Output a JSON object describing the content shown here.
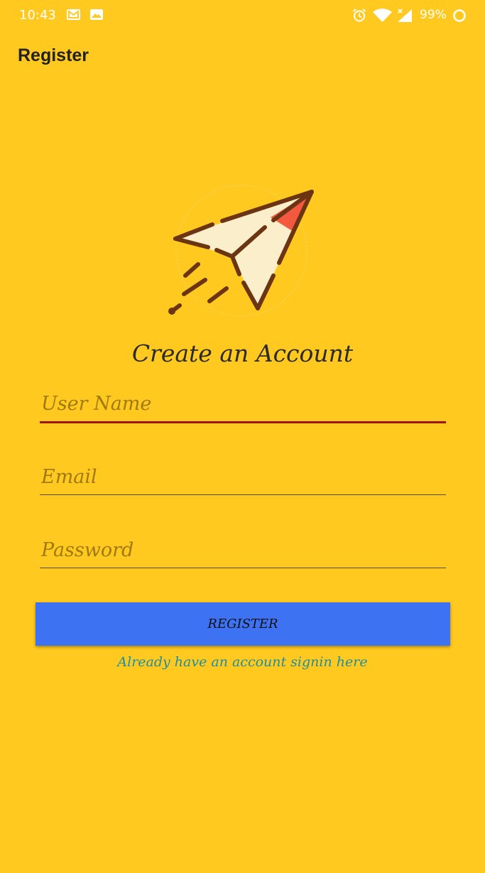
{
  "status_bar": {
    "time": "10:43",
    "battery": "99%",
    "icons": [
      "mail-icon",
      "image-icon",
      "alarm-icon",
      "wifi-icon",
      "signal-icon",
      "battery-icon"
    ]
  },
  "app_bar": {
    "title": "Register"
  },
  "logo": {
    "icon": "paper-plane-icon"
  },
  "form": {
    "heading": "Create an Account",
    "username_placeholder": "User Name",
    "username_value": "",
    "email_placeholder": "Email",
    "email_value": "",
    "password_placeholder": "Password",
    "password_value": "",
    "register_label": "REGISTER",
    "signin_link": "Already have an account signin here"
  },
  "colors": {
    "background": "#FFC91F",
    "accent": "#3D72F2",
    "focused_underline": "#9B1410",
    "link": "#1E8FA0"
  }
}
